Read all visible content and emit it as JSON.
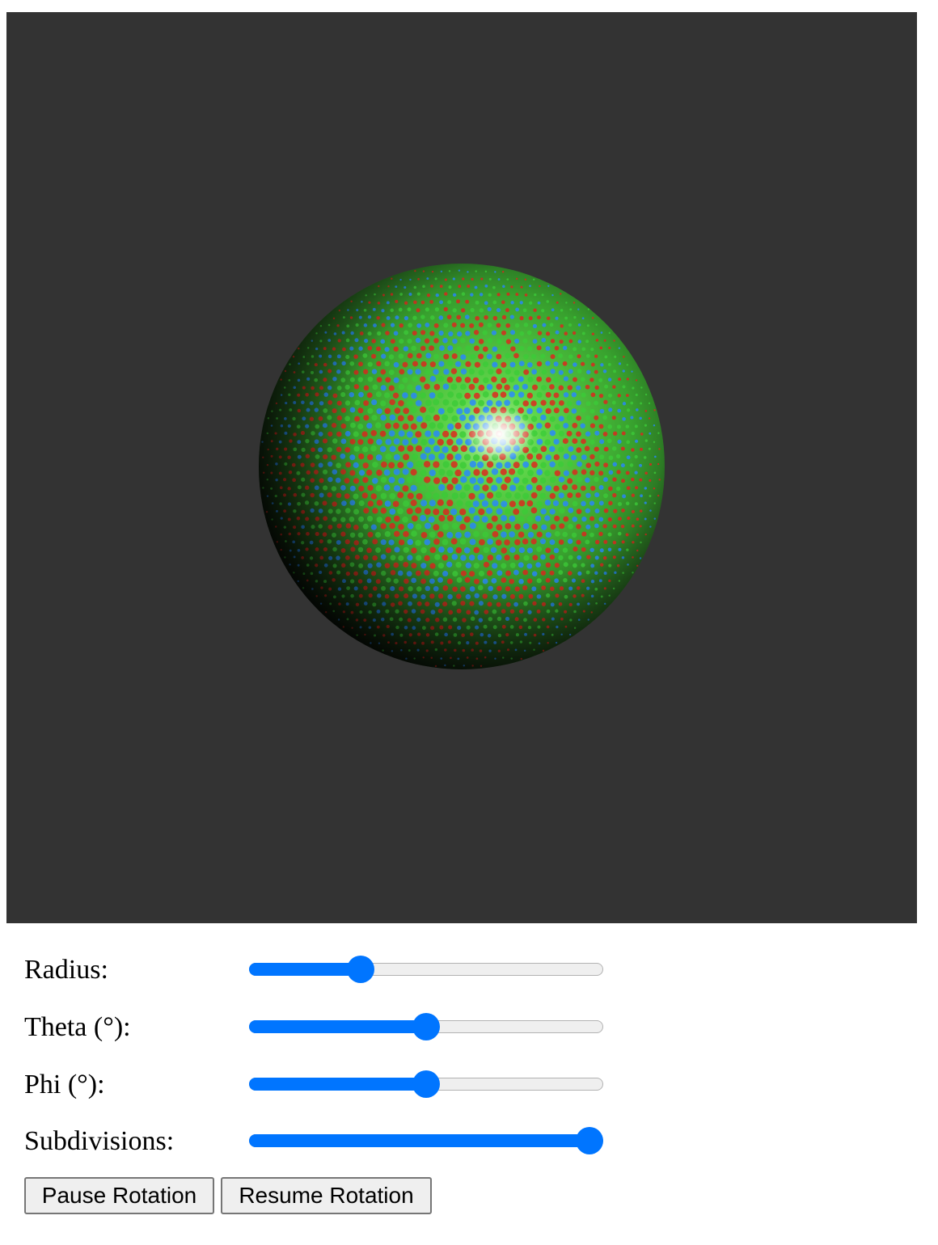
{
  "scene": {
    "background": "#333333",
    "sphere_palette": [
      "#3ecf3a",
      "#e02a1e",
      "#2a8cff",
      "#ffffff"
    ]
  },
  "controls": [
    {
      "label": "Radius:",
      "value_fraction": 0.3
    },
    {
      "label": "Theta (°):",
      "value_fraction": 0.5
    },
    {
      "label": "Phi (°):",
      "value_fraction": 0.5
    },
    {
      "label": "Subdivisions:",
      "value_fraction": 1.0
    }
  ],
  "buttons": {
    "pause_label": "Pause Rotation",
    "resume_label": "Resume Rotation"
  },
  "colors": {
    "accent": "#0075ff",
    "track": "#efefef"
  }
}
